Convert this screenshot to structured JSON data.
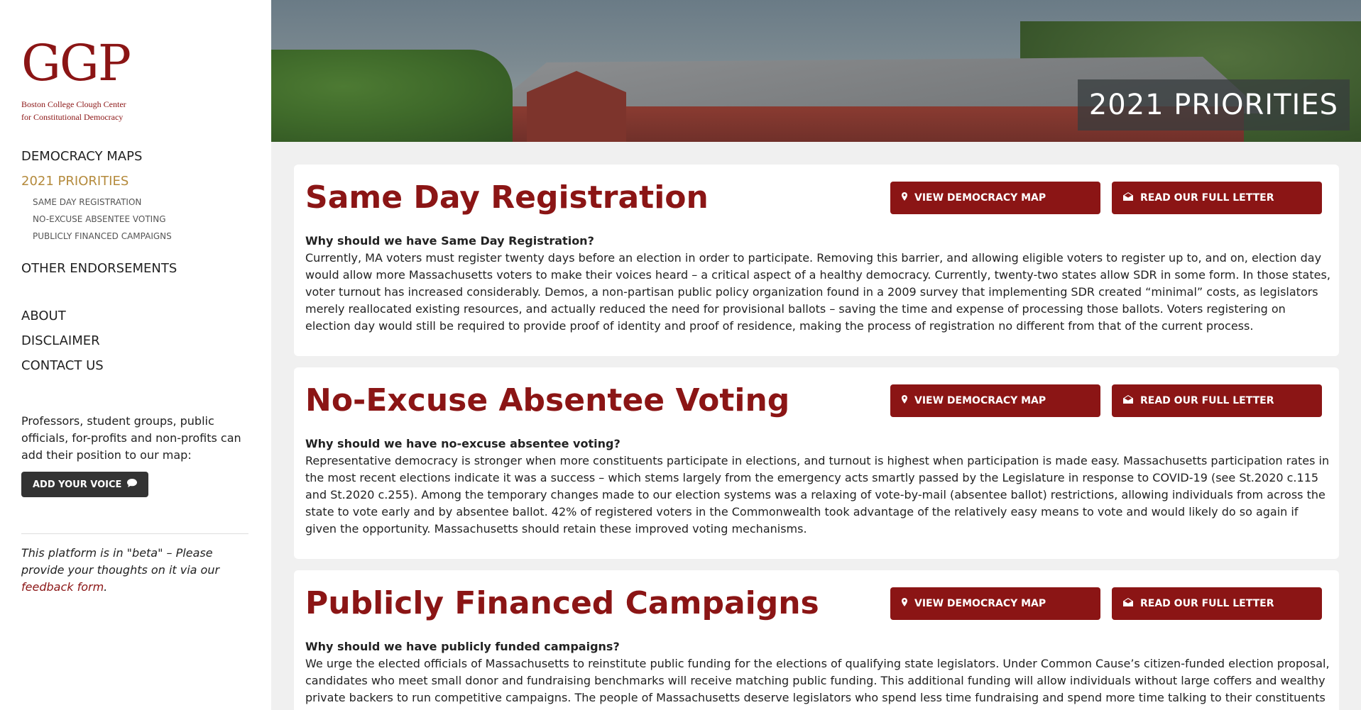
{
  "logo": {
    "mark": "GGP",
    "line1": "Boston College Clough Center",
    "line2": "for Constitutional Democracy"
  },
  "nav": {
    "democracy_maps": "DEMOCRACY MAPS",
    "priorities": "2021 PRIORITIES",
    "sub": [
      "SAME DAY REGISTRATION",
      "NO-EXCUSE ABSENTEE VOTING",
      "PUBLICLY FINANCED CAMPAIGNS"
    ],
    "other_endorsements": "OTHER ENDORSEMENTS",
    "about": "ABOUT",
    "disclaimer": "DISCLAIMER",
    "contact": "CONTACT US"
  },
  "sidebar": {
    "blurb": "Professors, student groups, public officials, for-profits and non-profits can add their position to our map:",
    "voice_button": "ADD YOUR VOICE",
    "beta_prefix": "This platform is in \"beta\" – Please provide your thoughts on it via our ",
    "beta_link": "feedback form",
    "beta_suffix": "."
  },
  "hero": {
    "title": "2021 PRIORITIES"
  },
  "buttons": {
    "map": "VIEW DEMOCRACY MAP",
    "letter": "READ OUR FULL LETTER"
  },
  "cards": [
    {
      "title": "Same Day Registration",
      "question": "Why should we have Same Day Registration?",
      "body": "Currently, MA voters must register twenty days before an election in order to participate. Removing this barrier, and allowing eligible voters to register up to, and on, election day would allow more Massachusetts voters to make their voices heard – a critical aspect of a healthy democracy. Currently, twenty-two states allow SDR in some form. In those states, voter turnout has increased considerably. Demos, a non-partisan public policy organization found in a 2009 survey that implementing SDR created “minimal” costs, as legislators merely reallocated existing resources, and actually reduced the need for provisional ballots – saving the time and expense of processing those ballots. Voters registering on election day would still be required to provide proof of identity and proof of residence, making the process of registration no different from that of the current process."
    },
    {
      "title": "No-Excuse Absentee Voting",
      "question": "Why should we have no-excuse absentee voting?",
      "body": "Representative democracy is stronger when more constituents participate in elections, and turnout is highest when participation is made easy. Massachusetts participation rates in the most recent elections indicate it was a success – which stems largely from the emergency acts smartly passed by the Legislature in response to COVID-19 (see St.2020 c.115 and St.2020 c.255). Among the temporary changes made to our election systems was a relaxing of vote-by-mail (absentee ballot) restrictions, allowing individuals from across the state to vote early and by absentee ballot. 42% of registered voters in the Commonwealth took advantage of the relatively easy means to vote and would likely do so again if given the opportunity. Massachusetts should retain these improved voting mechanisms."
    },
    {
      "title": "Publicly Financed Campaigns",
      "question": "Why should we have publicly funded campaigns?",
      "body": "We urge the elected officials of Massachusetts to reinstitute public funding for the elections of qualifying state legislators. Under Common Cause’s citizen-funded election proposal, candidates who meet small donor and fundraising benchmarks  will receive matching public funding. This additional funding will allow individuals without large coffers and wealthy private backers to run competitive campaigns. The people of Massachusetts deserve legislators who spend less time fundraising and spend more time talking to their constituents and passing laws on their behalf."
    }
  ],
  "colors": {
    "brand_red": "#8b1515",
    "active_gold": "#b48a3c"
  }
}
